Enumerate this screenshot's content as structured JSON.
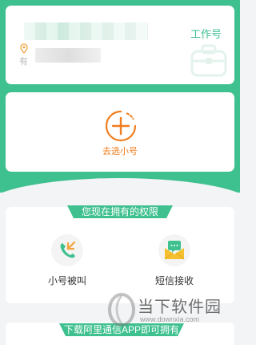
{
  "account": {
    "location_prefix": "有",
    "work_number_label": "工作号"
  },
  "add_number": {
    "label": "去选小号"
  },
  "permissions": {
    "title": "您现在拥有的权限",
    "items": [
      {
        "label": "小号被叫",
        "icon": "phone-call-icon"
      },
      {
        "label": "短信接收",
        "icon": "sms-envelope-icon"
      }
    ]
  },
  "download_banner": {
    "title": "下载阿里通信APP即可拥有"
  },
  "watermark": {
    "brand": "当下软件园",
    "url": "www.downxia.com"
  },
  "colors": {
    "accent_green": "#3ec08f",
    "accent_orange": "#f07d1e",
    "background": "#f3f4f6"
  }
}
